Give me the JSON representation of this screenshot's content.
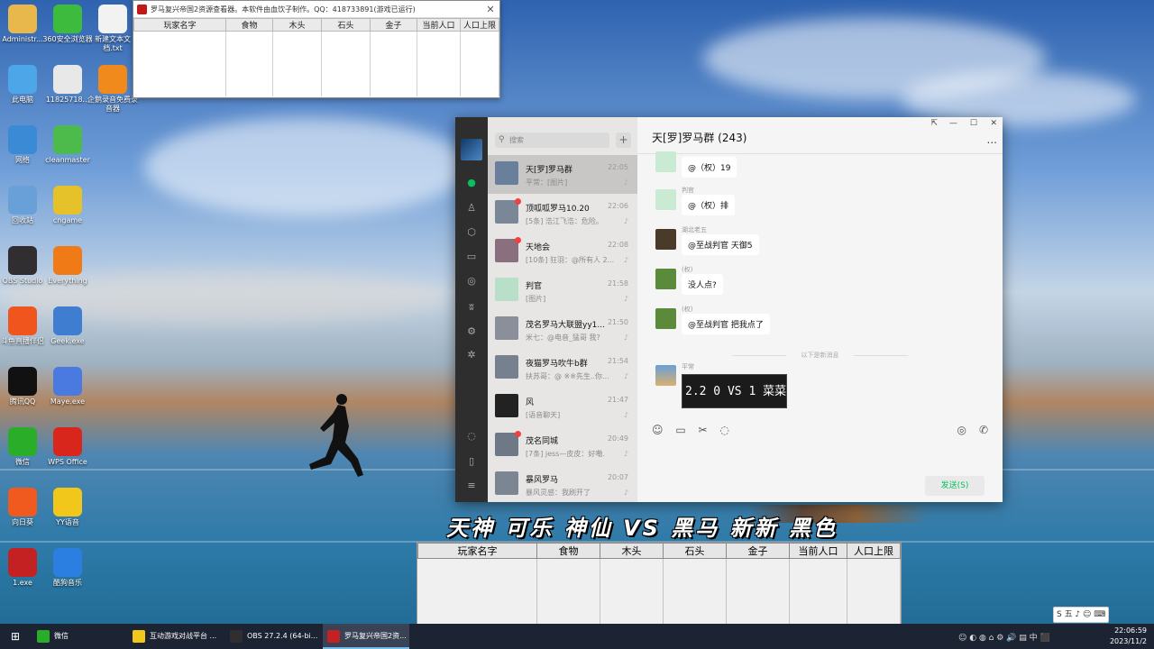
{
  "desktop_icons": [
    {
      "label": "Administr...",
      "color": "#e8b84d"
    },
    {
      "label": "360安全浏览器",
      "color": "#3dbb3d"
    },
    {
      "label": "新建文本文档.txt",
      "color": "#f2f2f2"
    },
    {
      "label": "此电脑",
      "color": "#4ca6e8"
    },
    {
      "label": "11825718...",
      "color": "#e8e8e8"
    },
    {
      "label": "企鹅录音免费录音器",
      "color": "#f08a1c"
    },
    {
      "label": "网络",
      "color": "#3a8ad6"
    },
    {
      "label": "cleanmaster",
      "color": "#4cbb4c"
    },
    {
      "label": "回收站",
      "color": "#6aa0d8"
    },
    {
      "label": "cngame",
      "color": "#e5c22a"
    },
    {
      "label": "OBS Studio",
      "color": "#302e31"
    },
    {
      "label": "Everything",
      "color": "#f07a16"
    },
    {
      "label": "斗鱼直播伴侣",
      "color": "#f0551e"
    },
    {
      "label": "Geek.exe",
      "color": "#3e7dcf"
    },
    {
      "label": "腾讯QQ",
      "color": "#111111"
    },
    {
      "label": "Maye.exe",
      "color": "#4a7ae0"
    },
    {
      "label": "微信",
      "color": "#2aae2a"
    },
    {
      "label": "WPS Office",
      "color": "#d9261c"
    },
    {
      "label": "向日葵",
      "color": "#f05a1e"
    },
    {
      "label": "YY语音",
      "color": "#f2c71c"
    },
    {
      "label": "1.exe",
      "color": "#c42222"
    },
    {
      "label": "酷狗音乐",
      "color": "#2a7fe0"
    }
  ],
  "small_window": {
    "title": "罗马复兴帝国2资源查看器。本软件由血饮子制作。QQ：418733891(游戏已运行)",
    "close": "✕",
    "columns": [
      "玩家名字",
      "食物",
      "木头",
      "石头",
      "金子",
      "当前人口",
      "人口上限"
    ]
  },
  "wechat": {
    "search_placeholder": "搜索",
    "plus": "+",
    "nav_icons": [
      "chat-icon",
      "contacts-icon",
      "favorites-icon",
      "files-icon",
      "moments-icon",
      "channels-icon",
      "miniprogram-icon",
      "search-feed-icon",
      "mini-icon",
      "phone-icon",
      "menu-icon"
    ],
    "chats": [
      {
        "name": "天[罗]罗马群",
        "time": "22:05",
        "msg": "平常：[图片]",
        "color": "#6a7f9c",
        "dot": false
      },
      {
        "name": "顶呱呱罗马10.20",
        "time": "22:06",
        "msg": "[5条] 浩江飞浩：危险。",
        "color": "#7a8796",
        "dot": true
      },
      {
        "name": "天地会",
        "time": "22:08",
        "msg": "[10条] 狂羽：@所有人 2...",
        "color": "#8a6f7e",
        "dot": true
      },
      {
        "name": "判官",
        "time": "21:58",
        "msg": "[图片]",
        "color": "#b8e0c8",
        "dot": false
      },
      {
        "name": "茂名罗马大联盟yy1...",
        "time": "21:50",
        "msg": "米七：@电音_猛哥 我?",
        "color": "#8b8f9a",
        "dot": false
      },
      {
        "name": "夜猫罗马吹牛b群",
        "time": "21:54",
        "msg": "扶苏哥：@ ※※先生..你...",
        "color": "#77808e",
        "dot": false
      },
      {
        "name": "风",
        "time": "21:47",
        "msg": "[语音聊天]",
        "color": "#222222",
        "dot": false
      },
      {
        "name": "茂名同城",
        "time": "20:49",
        "msg": "[7条] jess—皮皮：好嘞.",
        "color": "#6f7887",
        "dot": true
      },
      {
        "name": "暴风罗马",
        "time": "20:07",
        "msg": "暴风灵感：我刷开了",
        "color": "#7c8592",
        "dot": false
      }
    ],
    "title": "天[罗]罗马群 (243)",
    "title_more": "...",
    "window_controls": [
      "⇱",
      "—",
      "☐",
      "✕"
    ],
    "messages": [
      {
        "name": "",
        "text": "@（权）19",
        "color": "#c9ead3"
      },
      {
        "name": "判官",
        "text": "@（权）排",
        "color": "#c9ead3"
      },
      {
        "name": "湖北老五",
        "text": "@至战判官 天御5",
        "color": "#4a3a2a"
      },
      {
        "name": "(权)",
        "text": "没人点?",
        "color": "#5a8a3a"
      },
      {
        "name": "(权)",
        "text": "@至战判官 把我点了",
        "color": "#5a8a3a"
      }
    ],
    "new_divider": "以下是新消息",
    "last_sender": "平常",
    "video_caption": "2.2 0 VS 1 菜菜",
    "send_label": "发送(S)",
    "toolbar_icons": [
      "emoji-icon",
      "folder-icon",
      "scissors-icon",
      "chat-bubble-icon"
    ],
    "toolbar_right_icons": [
      "video-icon",
      "phone-icon"
    ]
  },
  "subtitle": "天神 可乐 神仙 VS 黑马 新新 黑色",
  "big_table": {
    "columns": [
      "玩家名字",
      "食物",
      "木头",
      "石头",
      "金子",
      "当前人口",
      "人口上限"
    ]
  },
  "taskbar": {
    "items": [
      {
        "label": "微信",
        "color": "#2aae2a",
        "active": false
      },
      {
        "label": "互动游戏对战平台 ...",
        "color": "#f2c71c",
        "active": false
      },
      {
        "label": "OBS 27.2.4 (64-bi...",
        "color": "#302e31",
        "active": false
      },
      {
        "label": "罗马复兴帝国2资...",
        "color": "#c42222",
        "active": true
      }
    ],
    "ime": "S 五 ♪ ☺ ⌨",
    "tray_text": "☺ ◐ ◍ ⌂ ⚙ 🔊 ▤ 中 ⬛",
    "time": "22:06:59",
    "date": "2023/11/2"
  }
}
